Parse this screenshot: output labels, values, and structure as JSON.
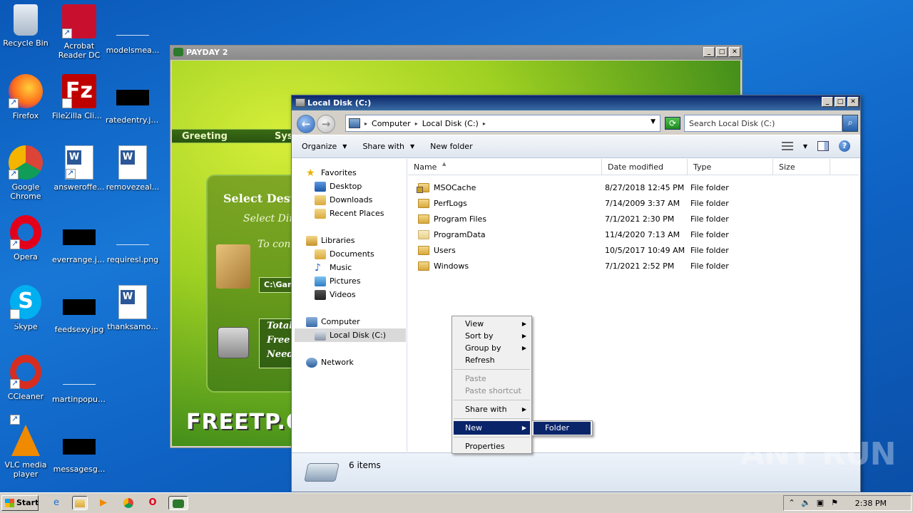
{
  "desktop": {
    "icons": [
      {
        "label": "Recycle Bin"
      },
      {
        "label": "Acrobat Reader DC"
      },
      {
        "label": "modelsmea..."
      },
      {
        "label": "Firefox"
      },
      {
        "label": "FileZilla Client"
      },
      {
        "label": "ratedentry.jpg"
      },
      {
        "label": "Google Chrome"
      },
      {
        "label": "answeroffe..."
      },
      {
        "label": "removezeal..."
      },
      {
        "label": "Opera"
      },
      {
        "label": "everrange.jpg"
      },
      {
        "label": "requiresl.png"
      },
      {
        "label": "Skype"
      },
      {
        "label": "feedsexy.jpg"
      },
      {
        "label": "thanksamo..."
      },
      {
        "label": "CCleaner"
      },
      {
        "label": "martinpopul..."
      },
      {
        "label": "VLC media player"
      },
      {
        "label": "messagesg..."
      }
    ]
  },
  "payday": {
    "title": "PAYDAY 2",
    "tabs": [
      "Greeting",
      "Sys"
    ],
    "panel_title": "Select Dest",
    "panel_sub1": "Select Dir",
    "panel_sub2": "To con",
    "path_value": "C:\\Gam",
    "info_lines": [
      "Total",
      "Free S",
      "Need S"
    ],
    "brand": "FREETP.OR"
  },
  "explorer": {
    "title": "Local Disk (C:)",
    "address": {
      "crumbs": [
        "Computer",
        "Local Disk (C:)"
      ]
    },
    "search_placeholder": "Search Local Disk (C:)",
    "toolbar": {
      "organize": "Organize",
      "share_with": "Share with",
      "new_folder": "New folder"
    },
    "nav": {
      "favorites": "Favorites",
      "desktop": "Desktop",
      "downloads": "Downloads",
      "recent": "Recent Places",
      "libraries": "Libraries",
      "documents": "Documents",
      "music": "Music",
      "pictures": "Pictures",
      "videos": "Videos",
      "computer": "Computer",
      "localdisk": "Local Disk (C:)",
      "network": "Network"
    },
    "columns": {
      "name": "Name",
      "date": "Date modified",
      "type": "Type",
      "size": "Size"
    },
    "files": [
      {
        "name": "MSOCache",
        "date": "8/27/2018 12:45 PM",
        "type": "File folder"
      },
      {
        "name": "PerfLogs",
        "date": "7/14/2009 3:37 AM",
        "type": "File folder"
      },
      {
        "name": "Program Files",
        "date": "7/1/2021 2:30 PM",
        "type": "File folder"
      },
      {
        "name": "ProgramData",
        "date": "11/4/2020 7:13 AM",
        "type": "File folder"
      },
      {
        "name": "Users",
        "date": "10/5/2017 10:49 AM",
        "type": "File folder"
      },
      {
        "name": "Windows",
        "date": "7/1/2021 2:52 PM",
        "type": "File folder"
      }
    ],
    "status": "6 items"
  },
  "context_menu": {
    "view": "View",
    "sort_by": "Sort by",
    "group_by": "Group by",
    "refresh": "Refresh",
    "paste": "Paste",
    "paste_shortcut": "Paste shortcut",
    "share_with": "Share with",
    "new": "New",
    "properties": "Properties",
    "submenu_folder": "Folder"
  },
  "watermark": "ANY RUN",
  "taskbar": {
    "start": "Start",
    "clock": "2:38 PM"
  }
}
